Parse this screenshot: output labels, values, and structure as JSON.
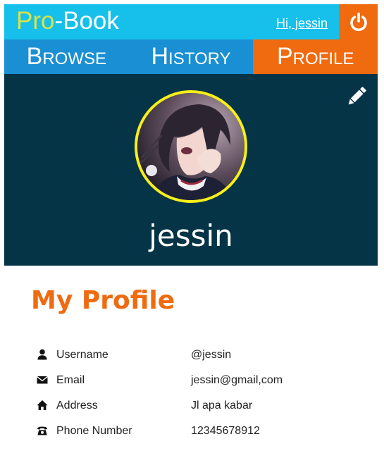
{
  "header": {
    "logo_pro": "Pro",
    "logo_dash": "-",
    "logo_book": "Book",
    "greeting": "Hi, jessin",
    "logout_icon": "power-icon"
  },
  "tabs": [
    {
      "label": "Browse",
      "active": false
    },
    {
      "label": "History",
      "active": false
    },
    {
      "label": "Profile",
      "active": true
    }
  ],
  "banner": {
    "name": "jessin",
    "edit_icon": "pencil-icon",
    "avatar_alt": "anime character avatar"
  },
  "profile": {
    "title": "My Profile",
    "rows": [
      {
        "icon": "user-icon",
        "label": "Username",
        "value": "@jessin"
      },
      {
        "icon": "envelope-icon",
        "label": "Email",
        "value": "jessin@gmail,com"
      },
      {
        "icon": "home-icon",
        "label": "Address",
        "value": "Jl apa kabar"
      },
      {
        "icon": "phone-icon",
        "label": "Phone Number",
        "value": "12345678912"
      }
    ]
  },
  "colors": {
    "topbar": "#16c0ea",
    "tabs": "#1a8fd3",
    "accent": "#f06a0f",
    "banner": "#053447",
    "logo_pro": "#d8e34a",
    "avatar_ring": "#f7ef1a"
  }
}
